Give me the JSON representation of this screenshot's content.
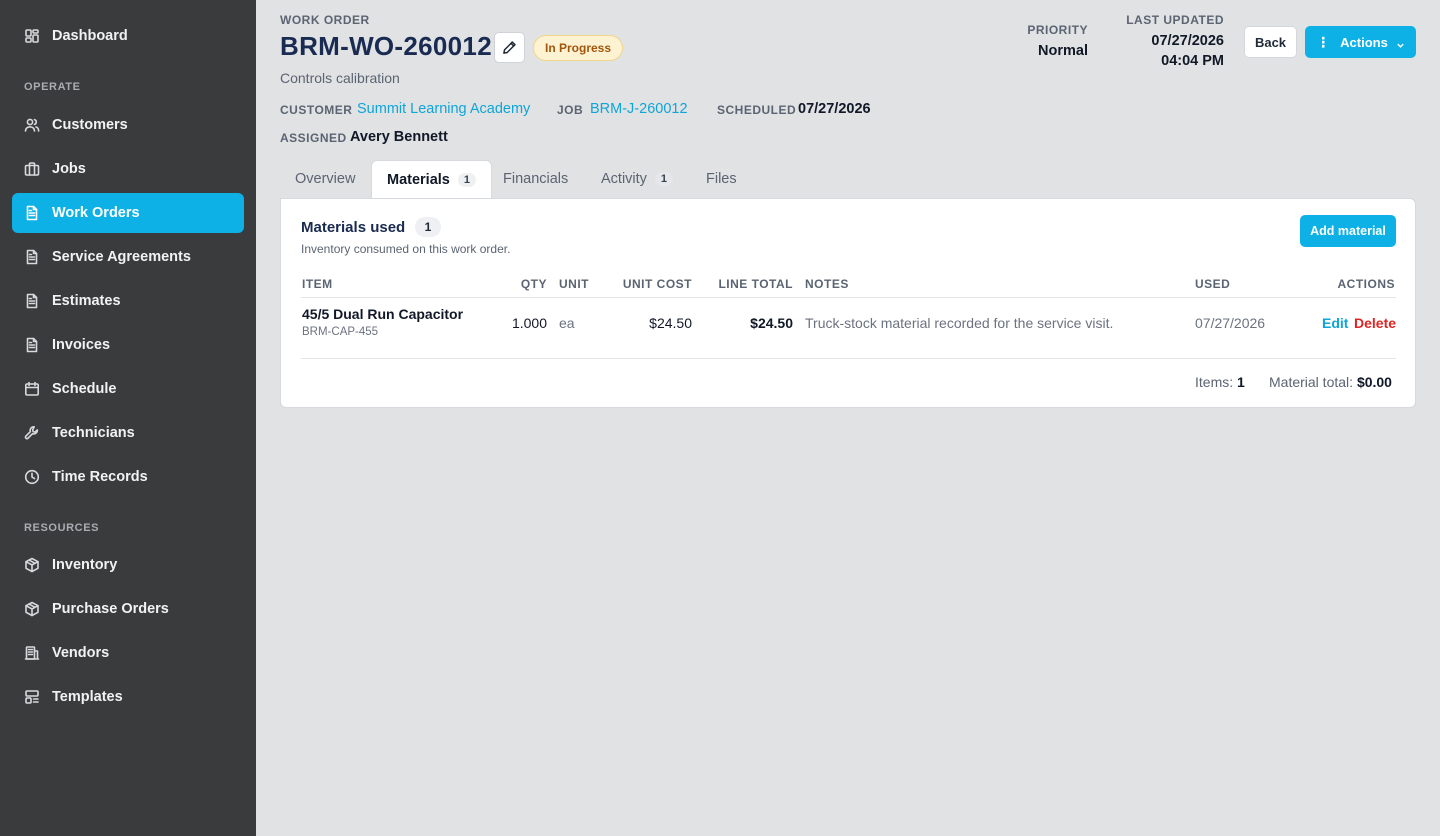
{
  "sidebar": {
    "items": [
      {
        "label": "Dashboard",
        "icon": "dashboard-icon"
      },
      {
        "label": "Customers",
        "icon": "users-icon"
      },
      {
        "label": "Jobs",
        "icon": "briefcase-icon"
      },
      {
        "label": "Work Orders",
        "icon": "document-icon"
      },
      {
        "label": "Service Agreements",
        "icon": "document-icon"
      },
      {
        "label": "Estimates",
        "icon": "document-icon"
      },
      {
        "label": "Invoices",
        "icon": "document-icon"
      },
      {
        "label": "Schedule",
        "icon": "calendar-icon"
      },
      {
        "label": "Technicians",
        "icon": "wrench-icon"
      },
      {
        "label": "Time Records",
        "icon": "clock-icon"
      },
      {
        "label": "Inventory",
        "icon": "box-icon"
      },
      {
        "label": "Purchase Orders",
        "icon": "box-icon"
      },
      {
        "label": "Vendors",
        "icon": "building-icon"
      },
      {
        "label": "Templates",
        "icon": "template-icon"
      }
    ],
    "sections": {
      "operate": "OPERATE",
      "resources": "RESOURCES"
    },
    "active": "Work Orders"
  },
  "header": {
    "eyebrow": "WORK ORDER",
    "title": "BRM-WO-260012",
    "status": "In Progress",
    "subtitle": "Controls calibration",
    "customer_label": "CUSTOMER",
    "customer": "Summit Learning Academy",
    "job_label": "JOB",
    "job": "BRM-J-260012",
    "scheduled_label": "SCHEDULED",
    "scheduled": "07/27/2026",
    "assigned_label": "ASSIGNED",
    "assigned": "Avery Bennett",
    "priority_label": "PRIORITY",
    "priority": "Normal",
    "updated_label": "LAST UPDATED",
    "updated_date": "07/27/2026",
    "updated_time": "04:04 PM",
    "back_label": "Back",
    "actions_label": "Actions"
  },
  "tabs": [
    {
      "label": "Overview",
      "count": null
    },
    {
      "label": "Materials",
      "count": "1"
    },
    {
      "label": "Financials",
      "count": null
    },
    {
      "label": "Activity",
      "count": "1"
    },
    {
      "label": "Files",
      "count": null
    }
  ],
  "materials": {
    "title": "Materials used",
    "count": "1",
    "description": "Inventory consumed on this work order.",
    "add_label": "Add material",
    "columns": {
      "item": "ITEM",
      "qty": "QTY",
      "unit": "UNIT",
      "unit_cost": "UNIT COST",
      "line_total": "LINE TOTAL",
      "notes": "NOTES",
      "used": "USED",
      "actions": "ACTIONS"
    },
    "rows": [
      {
        "item": "45/5 Dual Run Capacitor",
        "sku": "BRM-CAP-455",
        "qty": "1.000",
        "unit": "ea",
        "unit_cost": "$24.50",
        "line_total": "$24.50",
        "notes": "Truck-stock material recorded for the service visit.",
        "used": "07/27/2026",
        "edit_label": "Edit",
        "delete_label": "Delete"
      }
    ],
    "footer": {
      "items_label": "Items:",
      "items_value": "1",
      "total_label": "Material total:",
      "total_value": "$0.00"
    }
  },
  "colors": {
    "accent": "#0eb1e6",
    "sidebar": "#3a3b3d",
    "danger": "#dc2626"
  }
}
